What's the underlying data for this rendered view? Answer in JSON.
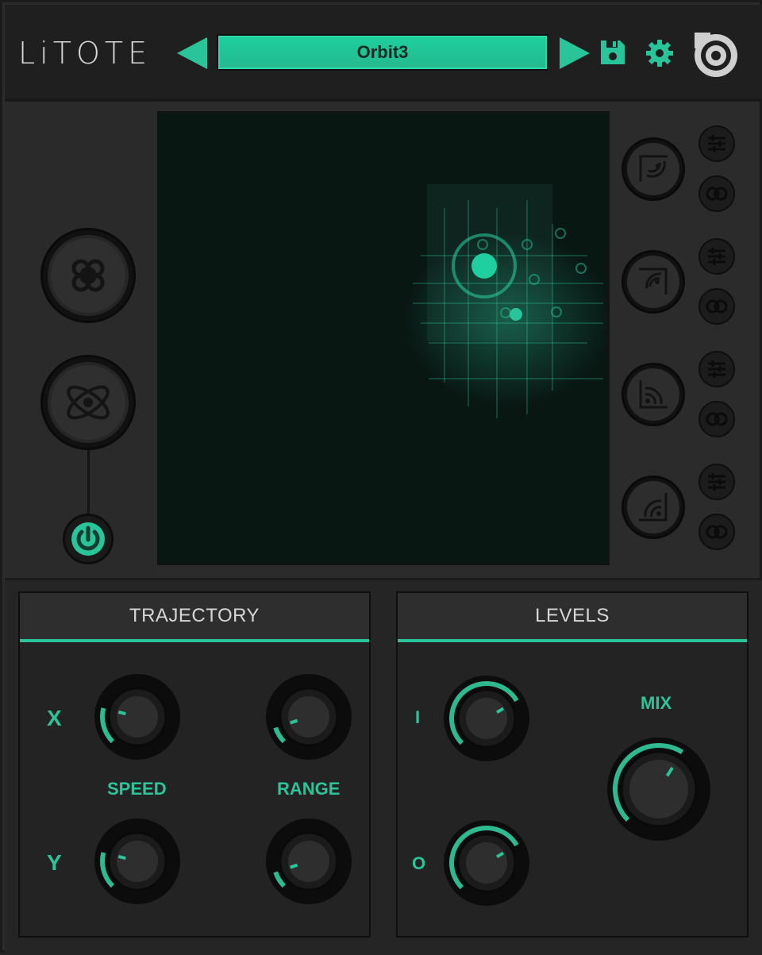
{
  "header": {
    "logo_text": "LiTOTE",
    "preset_name": "Orbit3",
    "icons": [
      "prev-arrow-icon",
      "next-arrow-icon",
      "save-icon",
      "gear-icon",
      "brand-logo-icon"
    ]
  },
  "left_panel": {
    "buttons": [
      "quad-source-icon",
      "orbit-atom-icon",
      "power-icon"
    ]
  },
  "right_panel": {
    "modes": [
      {
        "icon": "mode-1-icon",
        "settings_icon": "sliders-icon",
        "link_icon": "link-icon"
      },
      {
        "icon": "mode-2-icon",
        "settings_icon": "sliders-icon",
        "link_icon": "link-icon"
      },
      {
        "icon": "mode-3-icon",
        "settings_icon": "sliders-icon",
        "link_icon": "link-icon"
      },
      {
        "icon": "mode-4-icon",
        "settings_icon": "sliders-icon",
        "link_icon": "link-icon"
      }
    ]
  },
  "trajectory": {
    "title": "TRAJECTORY",
    "row_x": "X",
    "row_y": "Y",
    "speed_label": "SPEED",
    "range_label": "RANGE"
  },
  "levels": {
    "title": "LEVELS",
    "input_label": "I",
    "output_label": "O",
    "mix_label": "MIX"
  },
  "colors": {
    "accent": "#2ac49a",
    "background": "#2b2b2b",
    "pad": "#091713"
  },
  "knob_values": {
    "speed_x": 0.22,
    "speed_y": 0.22,
    "range_x": 0.1,
    "range_y": 0.1,
    "in_level": 0.72,
    "out_level": 0.72,
    "mix": 0.62
  }
}
